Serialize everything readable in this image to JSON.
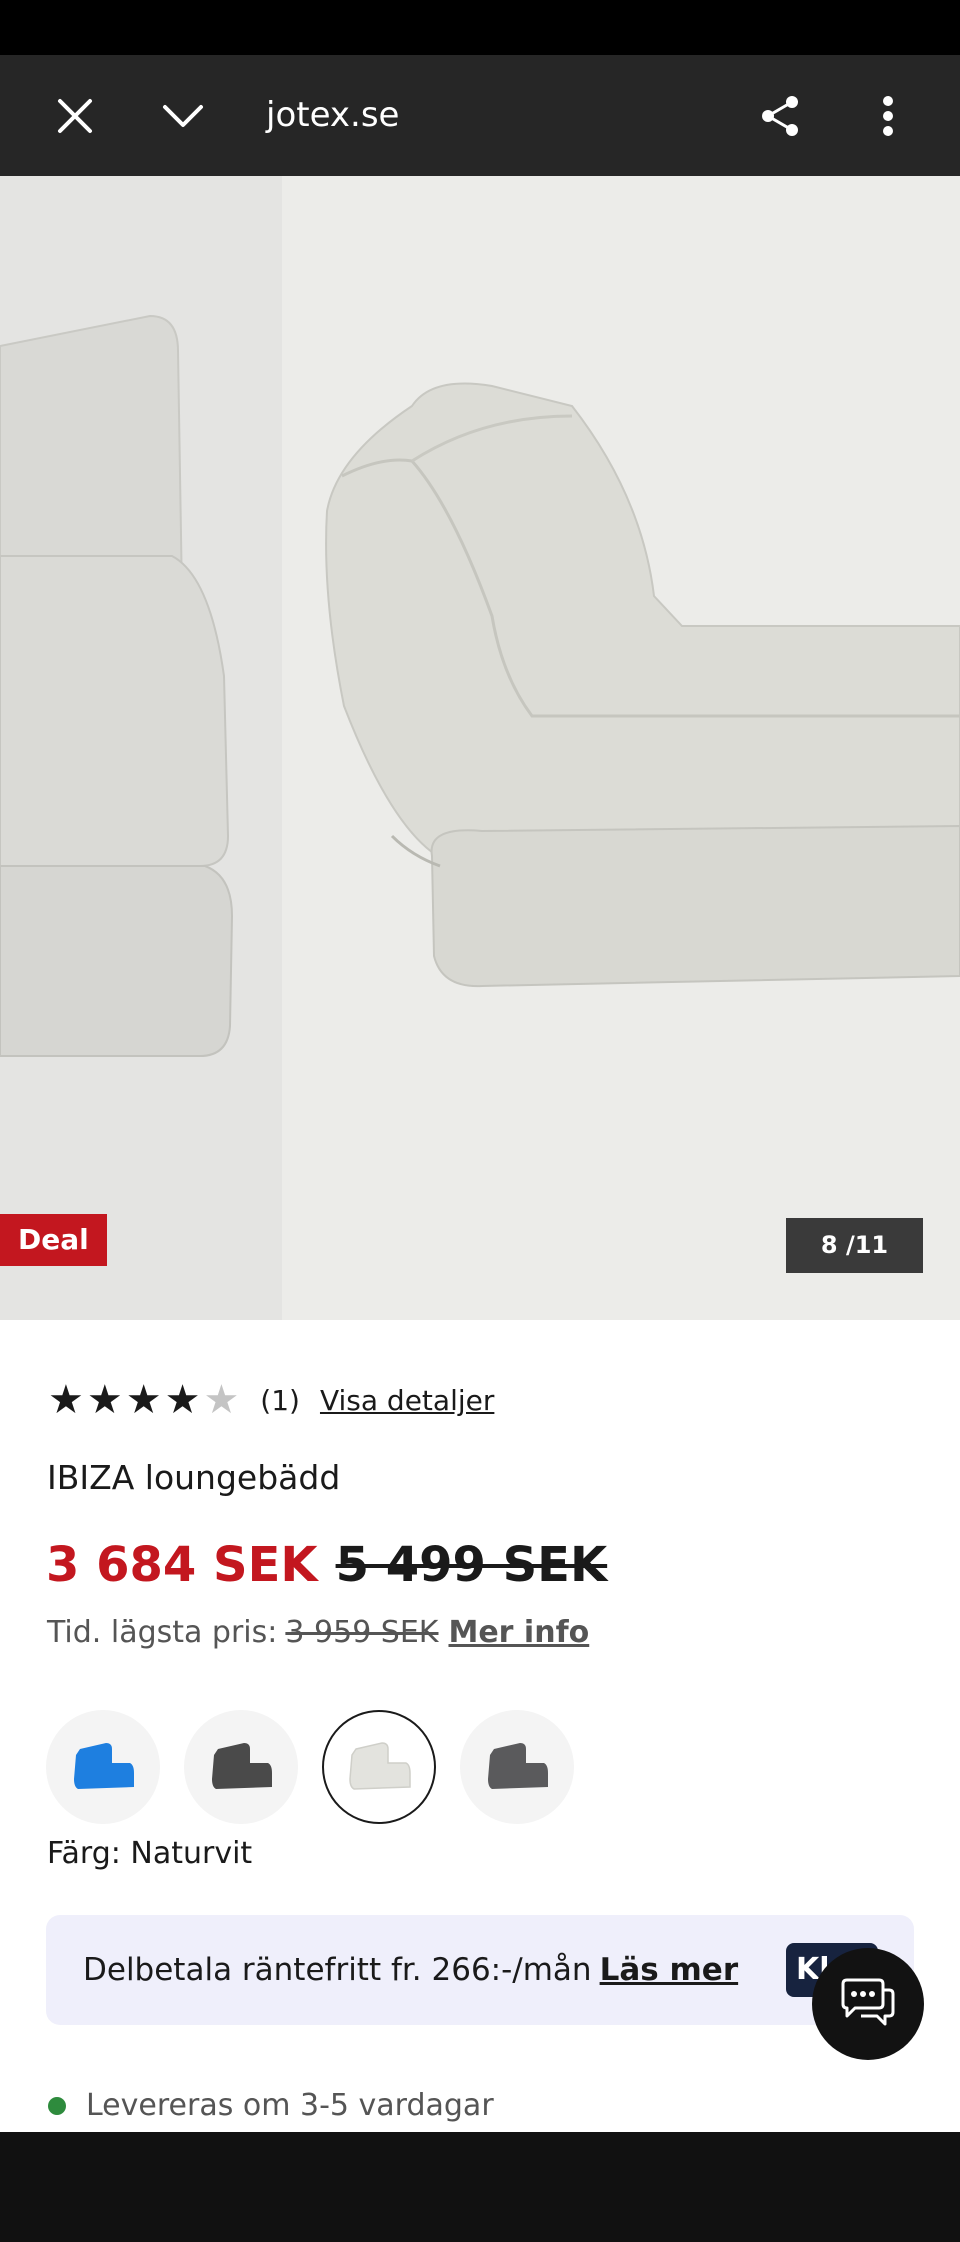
{
  "browser": {
    "url": "jotex.se"
  },
  "gallery": {
    "badge": "Deal",
    "counter": "8 /11"
  },
  "product": {
    "rating": {
      "stars_filled": 4,
      "stars_total": 5,
      "count": "(1)",
      "details_link": "Visa detaljer"
    },
    "title": "IBIZA loungebädd",
    "price_now": "3 684 SEK",
    "price_old": "5 499 SEK",
    "lowest_label": "Tid. lägsta pris:",
    "lowest_price": "3 959 SEK",
    "lowest_more": "Mer info",
    "color_label": "Färg: Naturvit",
    "swatches": [
      {
        "color": "#1e7fe0"
      },
      {
        "color": "#4a4a4a"
      },
      {
        "color": "#e3e3de"
      },
      {
        "color": "#5a5a5c"
      }
    ],
    "selected_swatch": 2
  },
  "klarna": {
    "text": "Delbetala räntefritt fr. 266:-/mån",
    "link": "Läs mer",
    "logo_text": "Kla"
  },
  "delivery": {
    "text": "Levereras om 3-5 vardagar"
  },
  "colors": {
    "accent_red": "#c3171f",
    "stock_green": "#2e8b3d"
  }
}
